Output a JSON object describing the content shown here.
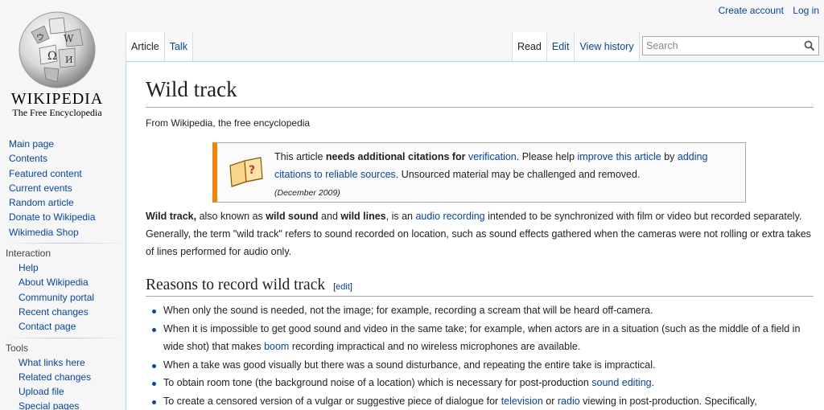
{
  "logo": {
    "wordmark": "WIKIPEDIA",
    "tagline": "The Free Encyclopedia"
  },
  "personal": {
    "create_account": "Create account",
    "login": "Log in"
  },
  "tabs": {
    "article": "Article",
    "talk": "Talk",
    "read": "Read",
    "edit": "Edit",
    "view_history": "View history"
  },
  "search": {
    "placeholder": "Search",
    "icon": "search-icon"
  },
  "sidebar": {
    "main": [
      "Main page",
      "Contents",
      "Featured content",
      "Current events",
      "Random article",
      "Donate to Wikipedia",
      "Wikimedia Shop"
    ],
    "interaction": {
      "heading": "Interaction",
      "items": [
        "Help",
        "About Wikipedia",
        "Community portal",
        "Recent changes",
        "Contact page"
      ]
    },
    "tools": {
      "heading": "Tools",
      "items": [
        "What links here",
        "Related changes",
        "Upload file",
        "Special pages"
      ]
    }
  },
  "article": {
    "title": "Wild track",
    "subtitle": "From Wikipedia, the free encyclopedia",
    "ambox": {
      "t1": "This article ",
      "t2": "needs additional citations for ",
      "t3": "verification",
      "t4": ". Please help ",
      "t5": "improve this article",
      "t6": " by ",
      "t7": "adding citations to reliable sources",
      "t8": ". Unsourced material may be challenged and removed.",
      "date": "(December 2009)"
    },
    "lead": {
      "b1": "Wild track,",
      "t1": " also known as ",
      "b2": "wild sound",
      "t2": " and ",
      "b3": "wild lines",
      "t3": ", is an ",
      "l1": "audio recording",
      "t4": " intended to be synchronized with film or video but recorded separately. Generally, the term \"wild track\" refers to sound recorded on location, such as sound effects gathered when the cameras were not rolling or extra takes of lines performed for audio only."
    },
    "section": {
      "title": "Reasons to record wild track",
      "edit": "edit"
    },
    "bullets": {
      "b1": "When only the sound is needed, not the image; for example, recording a scream that will be heard off-camera.",
      "b2a": "When it is impossible to get good sound and video in the same take; for example, when actors are in a situation (such as the middle of a field in wide shot) that makes ",
      "b2l": "boom",
      "b2b": " recording impractical and no wireless microphones are available.",
      "b3": "When a take was good visually but there was a sound disturbance, and repeating the entire take is impractical.",
      "b4a": "To obtain room tone (the background noise of a location) which is necessary for post-production ",
      "b4l": "sound editing",
      "b4b": ".",
      "b5a": "To create a censored version of a vulgar or suggestive piece of dialogue for ",
      "b5l1": "television",
      "b5m": " or ",
      "b5l2": "radio",
      "b5b": " viewing in post-production. Specifically,"
    }
  }
}
